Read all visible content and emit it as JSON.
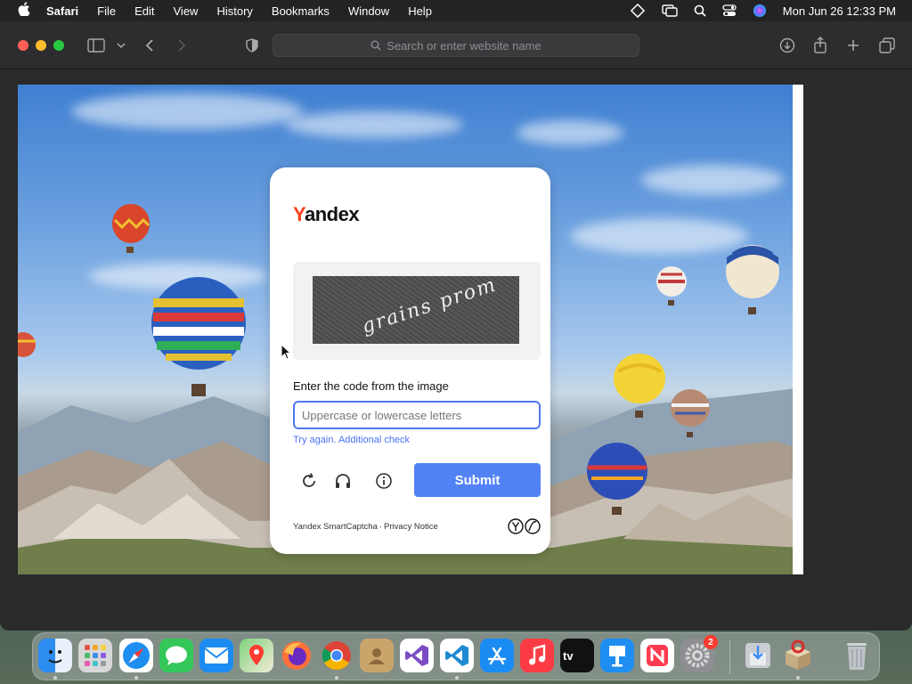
{
  "menubar": {
    "app_name": "Safari",
    "items": [
      "File",
      "Edit",
      "View",
      "History",
      "Bookmarks",
      "Window",
      "Help"
    ],
    "clock": "Mon Jun 26  12:33 PM"
  },
  "toolbar": {
    "address_placeholder": "Search or enter website name"
  },
  "captcha": {
    "logo_first": "Y",
    "logo_rest": "andex",
    "code_image_text": "grains prom",
    "label": "Enter the code from the image",
    "input_placeholder": "Uppercase or lowercase letters",
    "hint": "Try again. Additional check",
    "submit_label": "Submit",
    "footer_brand": "Yandex SmartCaptcha",
    "footer_separator": "·",
    "footer_link": "Privacy Notice"
  },
  "dock": {
    "apps": [
      "Finder",
      "Launchpad",
      "Safari",
      "Messages",
      "Mail",
      "Maps",
      "Firefox",
      "Chrome",
      "Contacts",
      "Visual Studio",
      "VS Code",
      "App Store",
      "Music",
      "Apple TV",
      "Keynote",
      "News",
      "System Settings",
      "Downloads",
      "Installer",
      "Trash"
    ],
    "settings_badge": "2"
  }
}
